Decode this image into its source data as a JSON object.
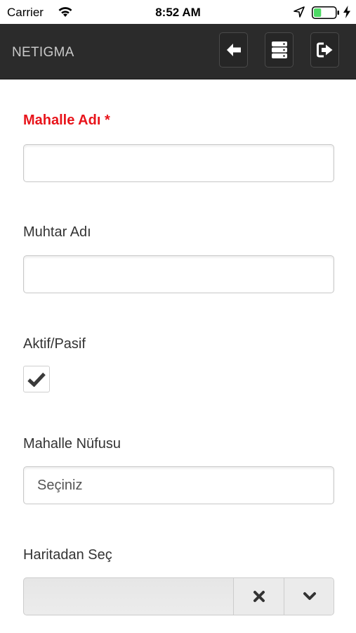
{
  "status_bar": {
    "carrier": "Carrier",
    "time": "8:52 AM",
    "battery_level": 0.35,
    "battery_color": "#4cd964"
  },
  "header": {
    "brand": "NETIGMA",
    "background": "#2b2b2b",
    "buttons": [
      {
        "icon": "arrow-left-icon"
      },
      {
        "icon": "server-list-icon"
      },
      {
        "icon": "logout-icon"
      }
    ]
  },
  "form": {
    "fields": [
      {
        "label": "Mahalle Adı *",
        "required": true,
        "type": "text",
        "value": ""
      },
      {
        "label": "Muhtar Adı",
        "required": false,
        "type": "text",
        "value": ""
      },
      {
        "label": "Aktif/Pasif",
        "required": false,
        "type": "checkbox",
        "checked": true
      },
      {
        "label": "Mahalle Nüfusu",
        "required": false,
        "type": "select",
        "value": "Seçiniz"
      },
      {
        "label": "Haritadan Seç",
        "required": false,
        "type": "combo",
        "value": "",
        "buttons": [
          "clear-icon",
          "chevron-down-icon"
        ]
      }
    ],
    "required_color": "#e8141b"
  }
}
